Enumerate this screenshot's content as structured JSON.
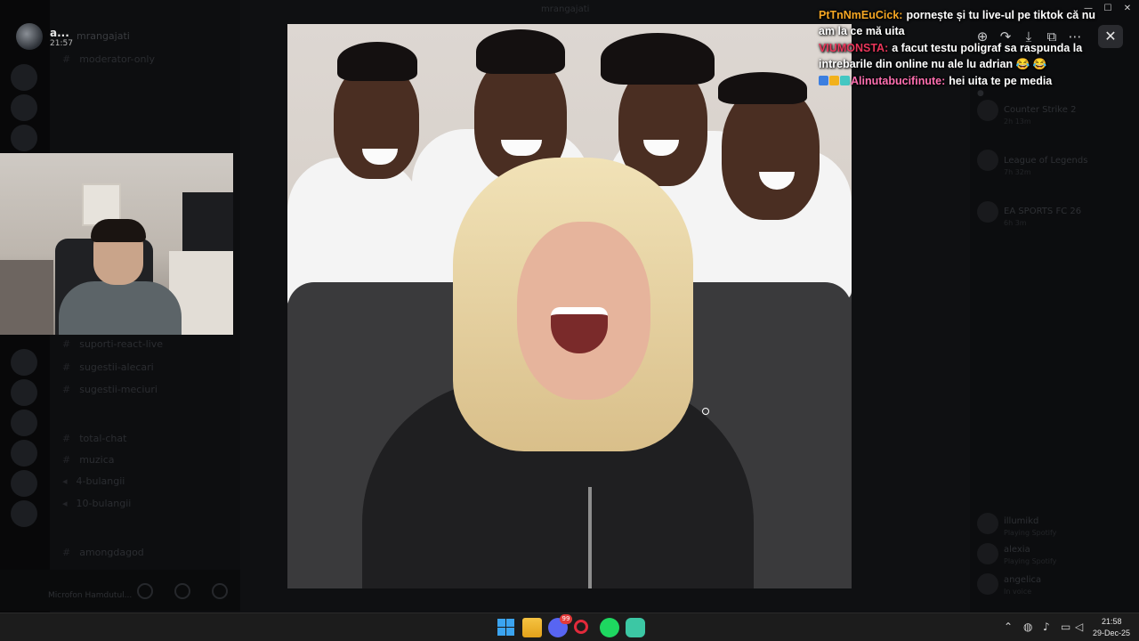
{
  "window": {
    "title": "mrangajati"
  },
  "discord": {
    "server_name": "mrangajati",
    "channels": [
      "moderator-only",
      "suporti-react-live",
      "sugestii-alecari",
      "sugestii-meciuri",
      "total-chat",
      "muzica",
      "4-bulangii",
      "10-bulangii",
      "amongdagod"
    ],
    "bottom_status": "Microfon Hamdutul...",
    "members": [
      {
        "name": "Counter Strike 2",
        "sub": "2h 13m"
      },
      {
        "name": "League of Legends",
        "sub": "7h 32m"
      },
      {
        "name": "EA SPORTS FC 26",
        "sub": "6h 3m"
      },
      {
        "name": "illumikd",
        "sub": "Playing Spotify"
      },
      {
        "name": "alexia",
        "sub": "Playing Spotify"
      },
      {
        "name": "angelica",
        "sub": "In voice"
      }
    ]
  },
  "streamer": {
    "name": "a...",
    "time": "21:57"
  },
  "chat": [
    {
      "user": "PtTnNmEuCick:",
      "user_color": "#f5a623",
      "text": "pornește și tu live-ul pe tiktok că nu am la ce mă uita"
    },
    {
      "user": "VIUMONSTA:",
      "user_color": "#e8365a",
      "text": "a facut testu poligraf sa raspunda la intrebarile din online nu ale lu adrian 😂 😂"
    },
    {
      "user": "Alinutabucifinute:",
      "user_color": "#ff6fb0",
      "text": "hei uita te pe media"
    }
  ],
  "viewer": {
    "toolbar": [
      "zoom-icon",
      "forward-icon",
      "download-icon",
      "open-external-icon",
      "more-icon"
    ],
    "close_glyph": "✕"
  },
  "taskbar": {
    "apps": [
      "start",
      "file-explorer",
      "discord",
      "opera-gx",
      "spotify",
      "chatgpt"
    ],
    "discord_badge": "99",
    "clock_time": "21:58",
    "clock_date": "29-Dec-25"
  }
}
